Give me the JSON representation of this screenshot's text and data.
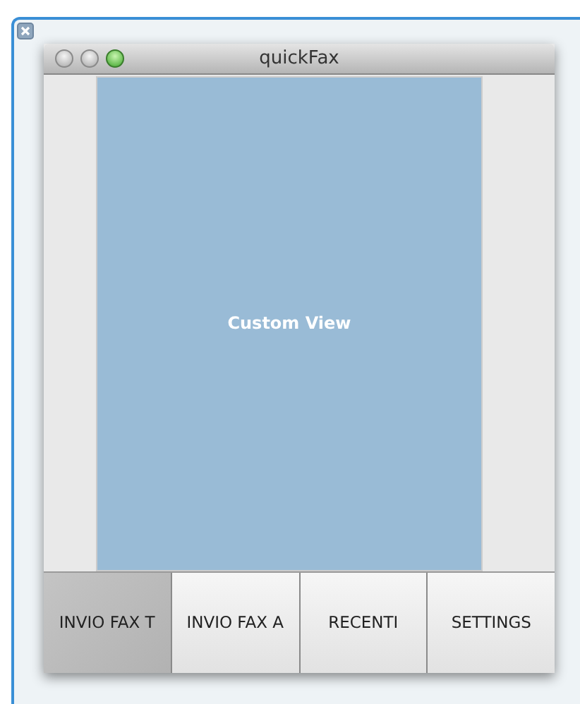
{
  "window": {
    "title": "quickFax"
  },
  "custom_view": {
    "label": "Custom View"
  },
  "tabs": [
    {
      "label": "INVIO FAX T",
      "selected": true
    },
    {
      "label": "INVIO FAX A",
      "selected": false
    },
    {
      "label": "RECENTI",
      "selected": false
    },
    {
      "label": "SETTINGS",
      "selected": false
    }
  ]
}
